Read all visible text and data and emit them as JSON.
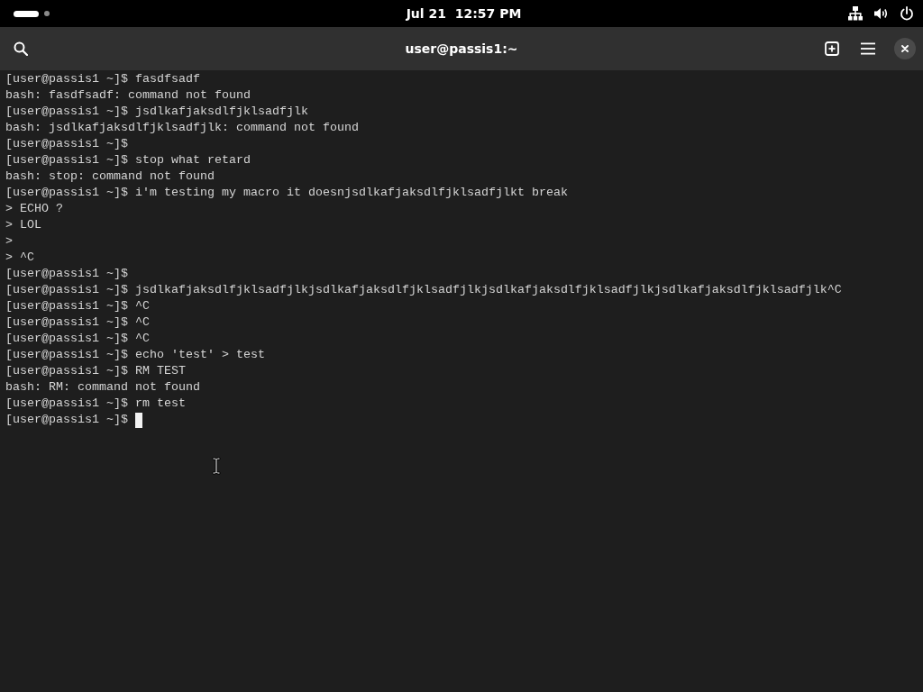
{
  "top_bar": {
    "workspaces": [
      {
        "selected": true
      },
      {
        "selected": false
      }
    ],
    "clock": "Jul 21  12:57 PM"
  },
  "header": {
    "title": "user@passis1:~"
  },
  "terminal": {
    "lines": [
      {
        "kind": "prompt",
        "prompt": "[user@passis1 ~]$",
        "command": "fasdfsadf"
      },
      {
        "kind": "output",
        "text": "bash: fasdfsadf: command not found"
      },
      {
        "kind": "prompt",
        "prompt": "[user@passis1 ~]$",
        "command": "jsdlkafjaksdlfjklsadfjlk"
      },
      {
        "kind": "output",
        "text": "bash: jsdlkafjaksdlfjklsadfjlk: command not found"
      },
      {
        "kind": "prompt",
        "prompt": "[user@passis1 ~]$"
      },
      {
        "kind": "prompt",
        "prompt": "[user@passis1 ~]$",
        "command": "stop what retard"
      },
      {
        "kind": "output",
        "text": "bash: stop: command not found"
      },
      {
        "kind": "prompt",
        "prompt": "[user@passis1 ~]$",
        "command": "i'm testing my macro it doesnjsdlkafjaksdlfjklsadfjlkt break"
      },
      {
        "kind": "prompt",
        "prompt": ">",
        "command": "ECHO ?"
      },
      {
        "kind": "prompt",
        "prompt": ">",
        "command": "LOL"
      },
      {
        "kind": "prompt",
        "prompt": ">"
      },
      {
        "kind": "prompt",
        "prompt": ">",
        "command": "^C"
      },
      {
        "kind": "prompt",
        "prompt": "[user@passis1 ~]$"
      },
      {
        "kind": "prompt",
        "prompt": "[user@passis1 ~]$",
        "command": "jsdlkafjaksdlfjklsadfjlkjsdlkafjaksdlfjklsadfjlkjsdlkafjaksdlfjklsadfjlkjsdlkafjaksdlfjklsadfjlk^C"
      },
      {
        "kind": "prompt",
        "prompt": "[user@passis1 ~]$",
        "command": "^C"
      },
      {
        "kind": "prompt",
        "prompt": "[user@passis1 ~]$",
        "command": "^C"
      },
      {
        "kind": "prompt",
        "prompt": "[user@passis1 ~]$",
        "command": "^C"
      },
      {
        "kind": "prompt",
        "prompt": "[user@passis1 ~]$",
        "command": "echo 'test' > test"
      },
      {
        "kind": "prompt",
        "prompt": "[user@passis1 ~]$",
        "command": "RM TEST"
      },
      {
        "kind": "output",
        "text": "bash: RM: command not found"
      },
      {
        "kind": "prompt",
        "prompt": "[user@passis1 ~]$",
        "command": "rm test"
      },
      {
        "kind": "input",
        "prompt": "[user@passis1 ~]$"
      }
    ]
  }
}
